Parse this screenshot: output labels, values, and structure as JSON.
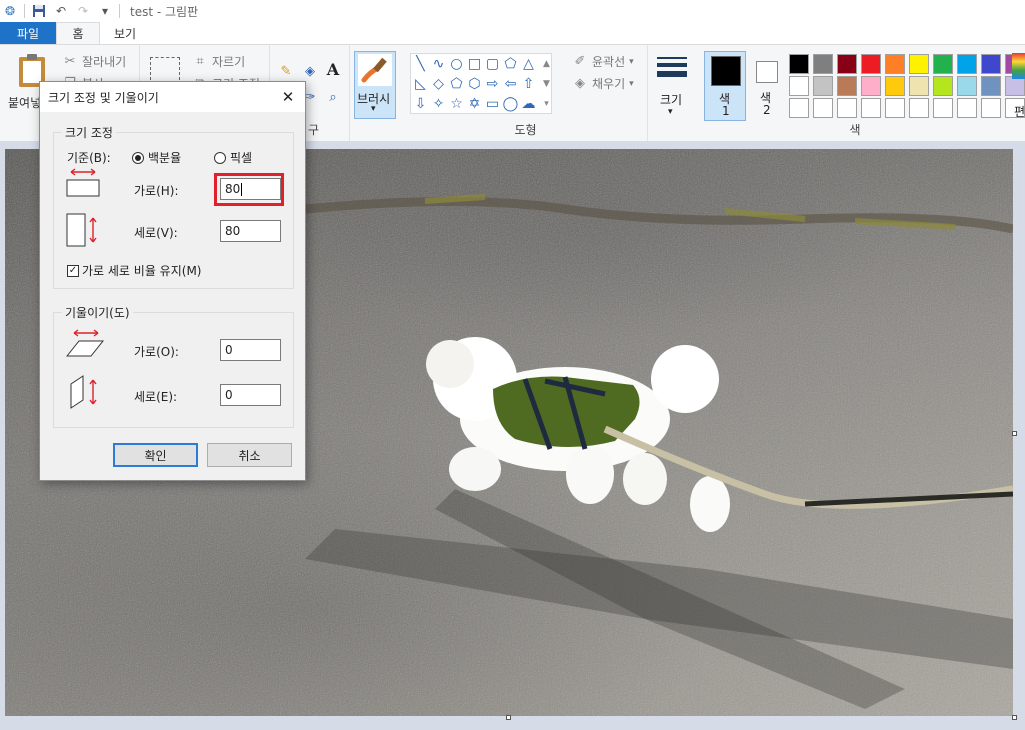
{
  "window": {
    "title": "test - 그림판"
  },
  "tabs": [
    {
      "label": "파일"
    },
    {
      "label": "홈"
    },
    {
      "label": "보기"
    }
  ],
  "ribbon": {
    "paste_label": "붙여넣",
    "cut_label": "잘라내기",
    "copy_label": "복사",
    "crop_label": "자르기",
    "resize_label": "크기 조정",
    "tools_group_label": "구",
    "brush_label": "브러시",
    "outline_label": "윤곽선",
    "fill_label": "채우기",
    "shapes_group_label": "도형",
    "size_label": "크기",
    "color1_label": "색",
    "color1_num": "1",
    "color2_label": "색",
    "color2_num": "2",
    "colors_group_label": "색",
    "edit_colors_label": "편"
  },
  "palette": [
    "#000000",
    "#7f7f7f",
    "#880015",
    "#ed1c24",
    "#ff7f27",
    "#fff200",
    "#22b14c",
    "#00a2e8",
    "#3f48cc",
    "#a349a4",
    "#ffffff",
    "#c3c3c3",
    "#b97a57",
    "#ffaec9",
    "#ffc90e",
    "#efe4b0",
    "#b5e61d",
    "#99d9ea",
    "#7092be",
    "#c8bfe7",
    "#ffffff",
    "#ffffff",
    "#ffffff",
    "#ffffff",
    "#ffffff",
    "#ffffff",
    "#ffffff",
    "#ffffff",
    "#ffffff",
    "#ffffff"
  ],
  "dialog": {
    "title": "크기 조정 및 기울이기",
    "resize_group": "크기 조정",
    "basis_label": "기준(B):",
    "percent_option": "백분율",
    "pixel_option": "픽셀",
    "horizontal_label": "가로(H):",
    "horizontal_value": "80",
    "vertical_label": "세로(V):",
    "vertical_value": "80",
    "keep_ratio_label": "가로 세로 비율 유지(M)",
    "skew_group": "기울이기(도)",
    "skew_h_label": "가로(O):",
    "skew_h_value": "0",
    "skew_v_label": "세로(E):",
    "skew_v_value": "0",
    "ok_label": "확인",
    "cancel_label": "취소"
  }
}
